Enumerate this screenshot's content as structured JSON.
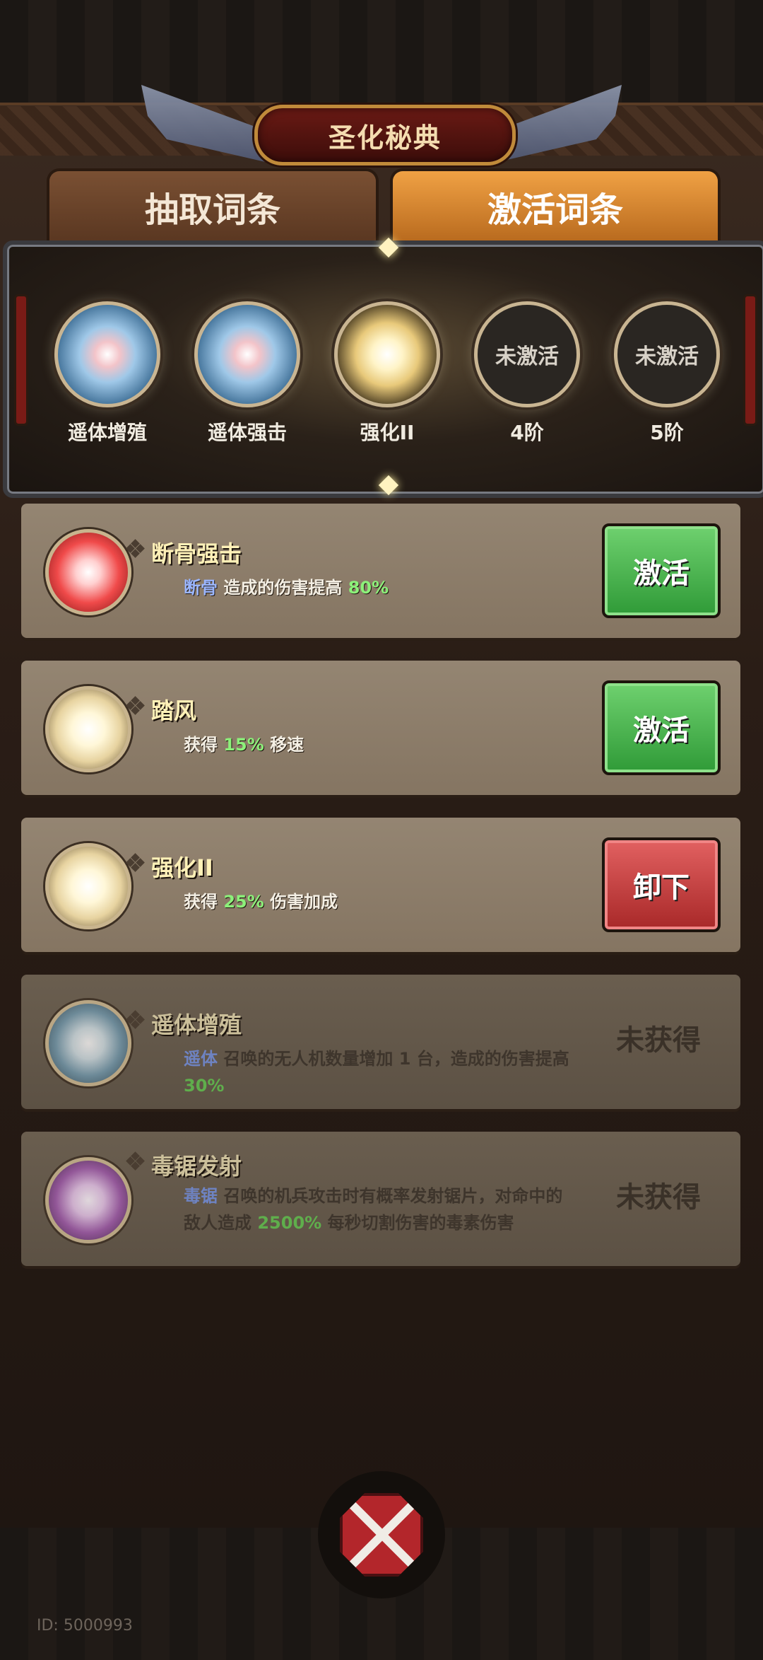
{
  "title": "圣化秘典",
  "tabs": [
    {
      "label": "抽取词条",
      "active": false
    },
    {
      "label": "激活词条",
      "active": true
    }
  ],
  "slots": [
    {
      "label": "遥体增殖",
      "state": "filled",
      "orb": "blue"
    },
    {
      "label": "遥体强击",
      "state": "filled",
      "orb": "blue"
    },
    {
      "label": "强化II",
      "state": "filled",
      "orb": "gold"
    },
    {
      "label": "4阶",
      "state": "empty",
      "empty_text": "未激活"
    },
    {
      "label": "5阶",
      "state": "empty",
      "empty_text": "未激活"
    }
  ],
  "cards": [
    {
      "name": "断骨强击",
      "orb": "red",
      "desc_kw": "断骨",
      "desc_a": " 造成的伤害提高 ",
      "desc_num": "80%",
      "desc_b": "",
      "action": "激活",
      "action_color": "green"
    },
    {
      "name": "踏风",
      "orb": "gold",
      "desc_kw": "",
      "desc_a": "获得 ",
      "desc_num": "15%",
      "desc_b": " 移速",
      "action": "激活",
      "action_color": "green"
    },
    {
      "name": "强化II",
      "orb": "gold",
      "desc_kw": "",
      "desc_a": "获得 ",
      "desc_num": "25%",
      "desc_b": " 伤害加成",
      "action": "卸下",
      "action_color": "red"
    },
    {
      "name": "遥体增殖",
      "orb": "teal",
      "desc_kw": "遥体",
      "desc_a": " 召唤的无人机数量增加 1 台，造成的伤害提高 ",
      "desc_num": "30%",
      "desc_b": "",
      "status": "未获得"
    },
    {
      "name": "毒锯发射",
      "orb": "purple",
      "desc_kw": "毒锯",
      "desc_a": " 召唤的机兵攻击时有概率发射锯片，对命中的敌人造成 ",
      "desc_num": "2500%",
      "desc_b": " 每秒切割伤害的毒素伤害",
      "status": "未获得"
    }
  ],
  "footer": {
    "id_text": "ID: 5000993",
    "close_icon": "crossed-swords-close-icon"
  },
  "colors": {
    "accent_gold": "#f0a144",
    "button_green": "#2f9a37",
    "button_red": "#a82828",
    "keyword_blue": "#9bb6ff",
    "number_green": "#8cf07a"
  }
}
